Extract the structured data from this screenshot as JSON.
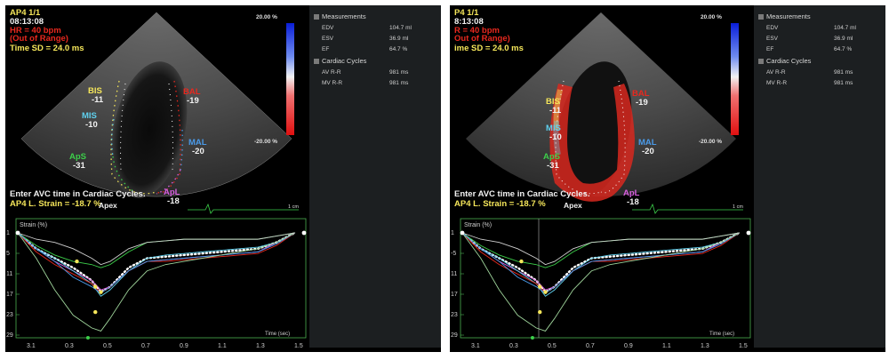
{
  "left": {
    "header": {
      "view": "AP4  1/1",
      "time": "08:13:08",
      "hr": "HR = 40 bpm",
      "hr_note": "(Out of  Range)",
      "sd": "Time SD = 24.0 ms"
    },
    "scale": {
      "top": "20.00 %",
      "bottom": "-20.00 %"
    },
    "segments": {
      "bis": {
        "name": "BIS",
        "value": "-11"
      },
      "bal": {
        "name": "BAL",
        "value": "-19"
      },
      "mis": {
        "name": "MIS",
        "value": "-10"
      },
      "mal": {
        "name": "MAL",
        "value": "-20"
      },
      "aps": {
        "name": "ApS",
        "value": "-31"
      },
      "apl": {
        "name": "ApL",
        "value": "-18"
      }
    },
    "apex": "Apex",
    "footer": {
      "instruction": "Enter AVC time in Cardiac Cycles.",
      "strain": "AP4 L. Strain = -18.7 %"
    },
    "cm": "1 cm",
    "graph": {
      "title": "Strain (%)",
      "y_ticks": [
        "1",
        "5",
        "11",
        "17",
        "23",
        "29"
      ],
      "x_ticks": [
        "3.1",
        "0.3",
        "0.5",
        "0.7",
        "0.9",
        "1.1",
        "1.3",
        "1.5"
      ],
      "xlabel": "Time (sec)"
    }
  },
  "right": {
    "header": {
      "view": "P4  1/1",
      "time": "8:13:08",
      "hr": "R = 40 bpm",
      "hr_note": "Out of  Range)",
      "sd": "ime SD = 24.0 ms"
    },
    "scale": {
      "top": "20.00 %",
      "bottom": "-20.00 %"
    },
    "segments": {
      "bis": {
        "name": "BIS",
        "value": "-11"
      },
      "bal": {
        "name": "BAL",
        "value": "-19"
      },
      "mis": {
        "name": "MIS",
        "value": "-10"
      },
      "mal": {
        "name": "MAL",
        "value": "-20"
      },
      "aps": {
        "name": "ApS",
        "value": "-31"
      },
      "apl": {
        "name": "ApL",
        "value": "-18"
      }
    },
    "apex": "Apex",
    "footer": {
      "instruction": "Enter AVC time in Cardiac Cycles.",
      "strain": "AP4 L. Strain = -18.7 %"
    },
    "cm": "1 cm",
    "graph": {
      "title": "Strain (%)",
      "y_ticks": [
        "1",
        "-5",
        "11",
        "17",
        "23",
        "29"
      ],
      "x_ticks": [
        "3.1",
        "0.3",
        "0.5",
        "0.7",
        "0.9",
        "1.1",
        "1.3",
        "1.5"
      ],
      "xlabel": "Time (sec)"
    }
  },
  "panel": {
    "measurements": "Measurements",
    "rows": [
      {
        "label": "EDV",
        "value": "104.7 ml"
      },
      {
        "label": "ESV",
        "value": "36.9 ml"
      },
      {
        "label": "EF",
        "value": "64.7 %"
      }
    ],
    "cycles": "Cardiac Cycles",
    "cycle_rows": [
      {
        "label": "AV R-R",
        "value": "981 ms"
      },
      {
        "label": "MV R-R",
        "value": "981 ms"
      }
    ]
  },
  "colors": {
    "bis": "#f5e65a",
    "bal": "#e8281e",
    "mis": "#5fd0ee",
    "mal": "#4a9ae8",
    "aps": "#3ccf4a",
    "apl": "#d95fe0",
    "background": "#000000",
    "panel": "#1c1f21"
  },
  "chart_data": {
    "type": "line",
    "title": "",
    "ylabel": "Strain (%)",
    "xlabel": "Time (sec)",
    "xlim": [
      0,
      1.55
    ],
    "x": [
      0.0,
      0.1,
      0.2,
      0.3,
      0.4,
      0.45,
      0.5,
      0.6,
      0.7,
      0.8,
      0.9,
      1.0,
      1.1,
      1.2,
      1.3,
      1.4,
      1.5
    ],
    "series": [
      {
        "color": "#ffffff",
        "dotted": true,
        "values": [
          0,
          -5,
          -8,
          -11,
          -15,
          -18.7,
          -17,
          -11,
          -8,
          -7.5,
          -7,
          -6.5,
          -6,
          -5.5,
          -5,
          -3,
          0
        ]
      },
      {
        "color": "#3ccf4a",
        "values": [
          0,
          -4,
          -7,
          -9,
          -10,
          -11,
          -10,
          -6,
          -3,
          -2.5,
          -2,
          -2,
          -2,
          -2,
          -2,
          -1,
          0
        ]
      },
      {
        "color": "#d95fe0",
        "values": [
          0,
          -5,
          -9,
          -12,
          -15,
          -18,
          -17,
          -12,
          -9,
          -8.5,
          -8,
          -7.5,
          -7,
          -6.5,
          -6,
          -3,
          0
        ]
      },
      {
        "color": "#5fd0ee",
        "values": [
          0,
          -5,
          -8,
          -12,
          -16,
          -20,
          -18,
          -12,
          -8,
          -7,
          -6.5,
          -6,
          -5.5,
          -5,
          -4.5,
          -3,
          0
        ]
      },
      {
        "color": "#e8281e",
        "values": [
          0,
          -6,
          -10,
          -13,
          -16,
          -19,
          -17,
          -12,
          -9,
          -9,
          -8.5,
          -8,
          -7.5,
          -7,
          -6.5,
          -4,
          0
        ]
      },
      {
        "color": "#4a9ae8",
        "values": [
          0,
          -5,
          -9,
          -14,
          -17,
          -19,
          -17,
          -12,
          -9,
          -8.5,
          -8,
          -7.5,
          -7,
          -6.5,
          -6,
          -3.5,
          0
        ]
      },
      {
        "color": "#9ed39a",
        "values": [
          0,
          -8,
          -18,
          -26,
          -30,
          -31,
          -27,
          -18,
          -12,
          -10,
          -9,
          -8,
          -7,
          -6,
          -5,
          -3,
          0
        ]
      },
      {
        "color": "#cfcfcf",
        "values": [
          0,
          -2,
          -3,
          -5,
          -8,
          -10,
          -9,
          -5,
          -3,
          -2.5,
          -2,
          -2,
          -2,
          -2,
          -2,
          -1,
          0
        ]
      }
    ]
  }
}
